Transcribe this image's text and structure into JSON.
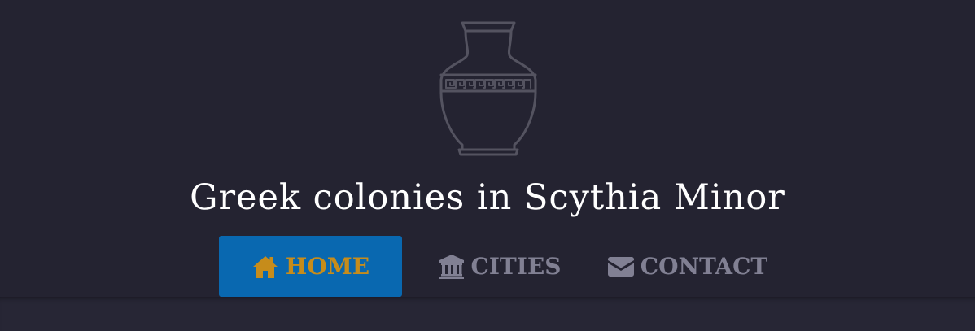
{
  "site": {
    "title": "Greek colonies in Scythia Minor",
    "logo_icon": "amphora-icon"
  },
  "nav": {
    "items": [
      {
        "label": "HOME",
        "icon": "home-icon",
        "active": true
      },
      {
        "label": "CITIES",
        "icon": "columns-building-icon",
        "active": false
      },
      {
        "label": "CONTACT",
        "icon": "envelope-icon",
        "active": false
      }
    ]
  },
  "colors": {
    "background": "#242331",
    "title": "#ffffff",
    "nav_text": "#818093",
    "nav_active_bg": "#0968b0",
    "nav_active_text": "#c68c1b",
    "logo_stroke": "#545360"
  }
}
